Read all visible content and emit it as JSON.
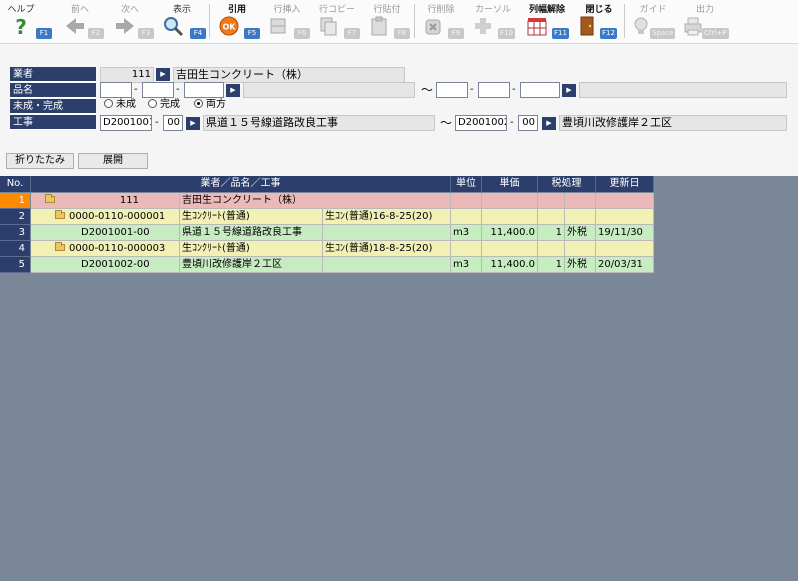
{
  "toolbar": {
    "help": {
      "label": "ヘルプ",
      "key": "F1"
    },
    "prev": {
      "label": "前へ",
      "key": "F2"
    },
    "next": {
      "label": "次へ",
      "key": "F3"
    },
    "show": {
      "label": "表示",
      "key": "F4"
    },
    "cite": {
      "label": "引用",
      "key": "F5"
    },
    "row_insert": {
      "label": "行挿入",
      "key": "F6"
    },
    "row_copy": {
      "label": "行コピー",
      "key": "F7"
    },
    "row_paste": {
      "label": "行貼付",
      "key": "F8"
    },
    "row_delete": {
      "label": "行削除",
      "key": "F9"
    },
    "cursor": {
      "label": "カーソル",
      "key": "F10"
    },
    "col_unlock": {
      "label": "列幅解除",
      "key": "F11"
    },
    "close": {
      "label": "閉じる",
      "key": "F12"
    },
    "guide": {
      "label": "ガイド",
      "key": "Space"
    },
    "output": {
      "label": "出力",
      "key": "Ctrl+P"
    }
  },
  "form": {
    "vendor": {
      "label": "業者",
      "code": "111",
      "name": "吉田生コンクリート（株）"
    },
    "item": {
      "label": "品名",
      "tilde": "〜"
    },
    "status": {
      "label": "未成・完成",
      "options": [
        "未成",
        "完成",
        "両方"
      ],
      "selected": "両方"
    },
    "work": {
      "label": "工事",
      "from_code": "D2001001",
      "from_sub": "00",
      "from_name": "県道１５号線道路改良工事",
      "tilde": "〜",
      "to_code": "D2001002",
      "to_sub": "00",
      "to_name": "豊頃川改修護岸２工区"
    },
    "collapse_label": "折りたたみ",
    "expand_label": "展開",
    "dash": "-"
  },
  "grid": {
    "headers": {
      "no": "No.",
      "name": "業者／品名／工事",
      "unit": "単位",
      "price": "単価",
      "tax": "税処理",
      "updated": "更新日"
    },
    "rows": [
      {
        "no": "1",
        "code": "111",
        "name": "吉田生コンクリート（株）",
        "spec": "",
        "unit": "",
        "price": "",
        "tax_num": "",
        "tax": "",
        "updated": ""
      },
      {
        "no": "2",
        "code": "0000-0110-000001",
        "name": "生ｺﾝｸﾘｰﾄ(普通)",
        "spec": "生ｺﾝ(普通)16-8-25(20)",
        "unit": "",
        "price": "",
        "tax_num": "",
        "tax": "",
        "updated": ""
      },
      {
        "no": "3",
        "code": "D2001001-00",
        "name": "県道１５号線道路改良工事",
        "spec": "",
        "unit": "m3",
        "price": "11,400.0",
        "tax_num": "1",
        "tax": "外税",
        "updated": "19/11/30"
      },
      {
        "no": "4",
        "code": "0000-0110-000003",
        "name": "生ｺﾝｸﾘｰﾄ(普通)",
        "spec": "生ｺﾝ(普通)18-8-25(20)",
        "unit": "",
        "price": "",
        "tax_num": "",
        "tax": "",
        "updated": ""
      },
      {
        "no": "5",
        "code": "D2001002-00",
        "name": "豊頃川改修護岸２工区",
        "spec": "",
        "unit": "m3",
        "price": "11,400.0",
        "tax_num": "1",
        "tax": "外税",
        "updated": "20/03/31"
      }
    ]
  },
  "icons": {
    "picker": "▶"
  }
}
